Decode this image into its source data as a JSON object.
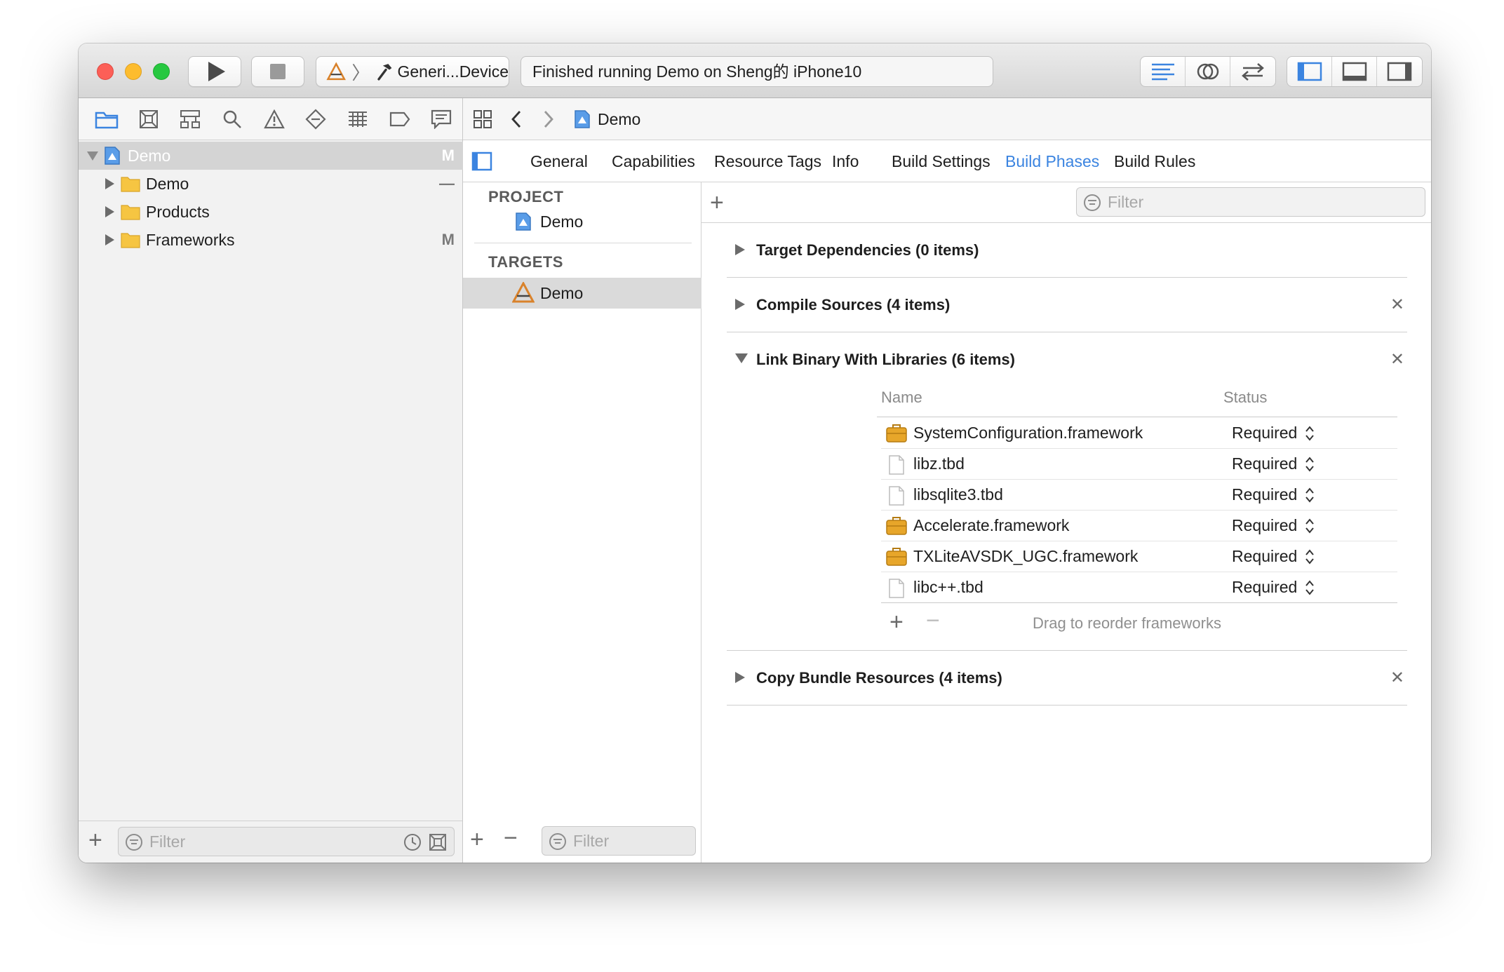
{
  "toolbar": {
    "scheme_target": "Generi...Device",
    "activity_text": "Finished running Demo on Sheng的 iPhone10"
  },
  "navigator": {
    "tree": [
      {
        "label": "Demo",
        "badge": "M",
        "selected": true,
        "expanded": true,
        "icon": "project-icon"
      },
      {
        "label": "Demo",
        "badge": "—",
        "icon": "folder-icon"
      },
      {
        "label": "Products",
        "badge": "",
        "icon": "folder-icon"
      },
      {
        "label": "Frameworks",
        "badge": "M",
        "icon": "folder-icon"
      }
    ],
    "filter_placeholder": "Filter"
  },
  "jumpbar": {
    "crumb": "Demo"
  },
  "tabs": [
    "General",
    "Capabilities",
    "Resource Tags",
    "Info",
    "Build Settings",
    "Build Phases",
    "Build Rules"
  ],
  "active_tab": "Build Phases",
  "targets_pane": {
    "project_header": "PROJECT",
    "project_item": "Demo",
    "targets_header": "TARGETS",
    "target_item": "Demo",
    "filter_placeholder": "Filter"
  },
  "phases": {
    "filter_placeholder": "Filter",
    "items": [
      {
        "title": "Target Dependencies (0 items)",
        "expanded": false,
        "removable": false
      },
      {
        "title": "Compile Sources (4 items)",
        "expanded": false,
        "removable": true
      },
      {
        "title": "Link Binary With Libraries (6 items)",
        "expanded": true,
        "removable": true
      },
      {
        "title": "Copy Bundle Resources (4 items)",
        "expanded": false,
        "removable": true
      }
    ],
    "libraries": {
      "col_name": "Name",
      "col_status": "Status",
      "rows": [
        {
          "name": "SystemConfiguration.framework",
          "status": "Required",
          "icon": "framework-icon"
        },
        {
          "name": "libz.tbd",
          "status": "Required",
          "icon": "file-icon"
        },
        {
          "name": "libsqlite3.tbd",
          "status": "Required",
          "icon": "file-icon"
        },
        {
          "name": "Accelerate.framework",
          "status": "Required",
          "icon": "framework-icon"
        },
        {
          "name": "TXLiteAVSDK_UGC.framework",
          "status": "Required",
          "icon": "framework-icon"
        },
        {
          "name": "libc++.tbd",
          "status": "Required",
          "icon": "file-icon"
        }
      ],
      "hint": "Drag to reorder frameworks"
    }
  },
  "colors": {
    "accent": "#3b84e0",
    "close": "#fc5f57",
    "minimize": "#fdbc2e",
    "zoom": "#27c840"
  }
}
